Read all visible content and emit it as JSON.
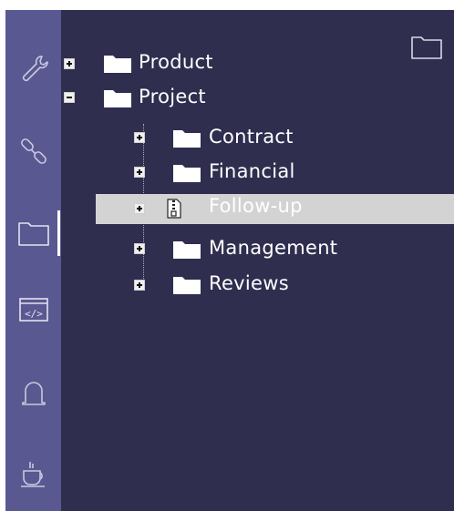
{
  "sidebar": {
    "items": [
      {
        "icon": "wrench-icon"
      },
      {
        "icon": "link-icon"
      },
      {
        "icon": "folder-icon",
        "active": true
      },
      {
        "icon": "code-window-icon"
      },
      {
        "icon": "bell-icon"
      },
      {
        "icon": "coffee-cup-icon"
      }
    ]
  },
  "tree": {
    "product_label": "Product",
    "project_label": "Project",
    "children": [
      {
        "label": "Contract",
        "icon": "folder-icon"
      },
      {
        "label": "Financial",
        "icon": "folder-icon"
      },
      {
        "label": "Follow-up",
        "icon": "zip-file-icon",
        "selected": true
      },
      {
        "label": "Management",
        "icon": "folder-icon"
      },
      {
        "label": "Reviews",
        "icon": "folder-icon"
      }
    ]
  },
  "colors": {
    "panel_bg": "#2f2e4f",
    "rail_bg": "#5a5890",
    "selection_bg": "#d3d3d3",
    "text": "#ffffff"
  }
}
